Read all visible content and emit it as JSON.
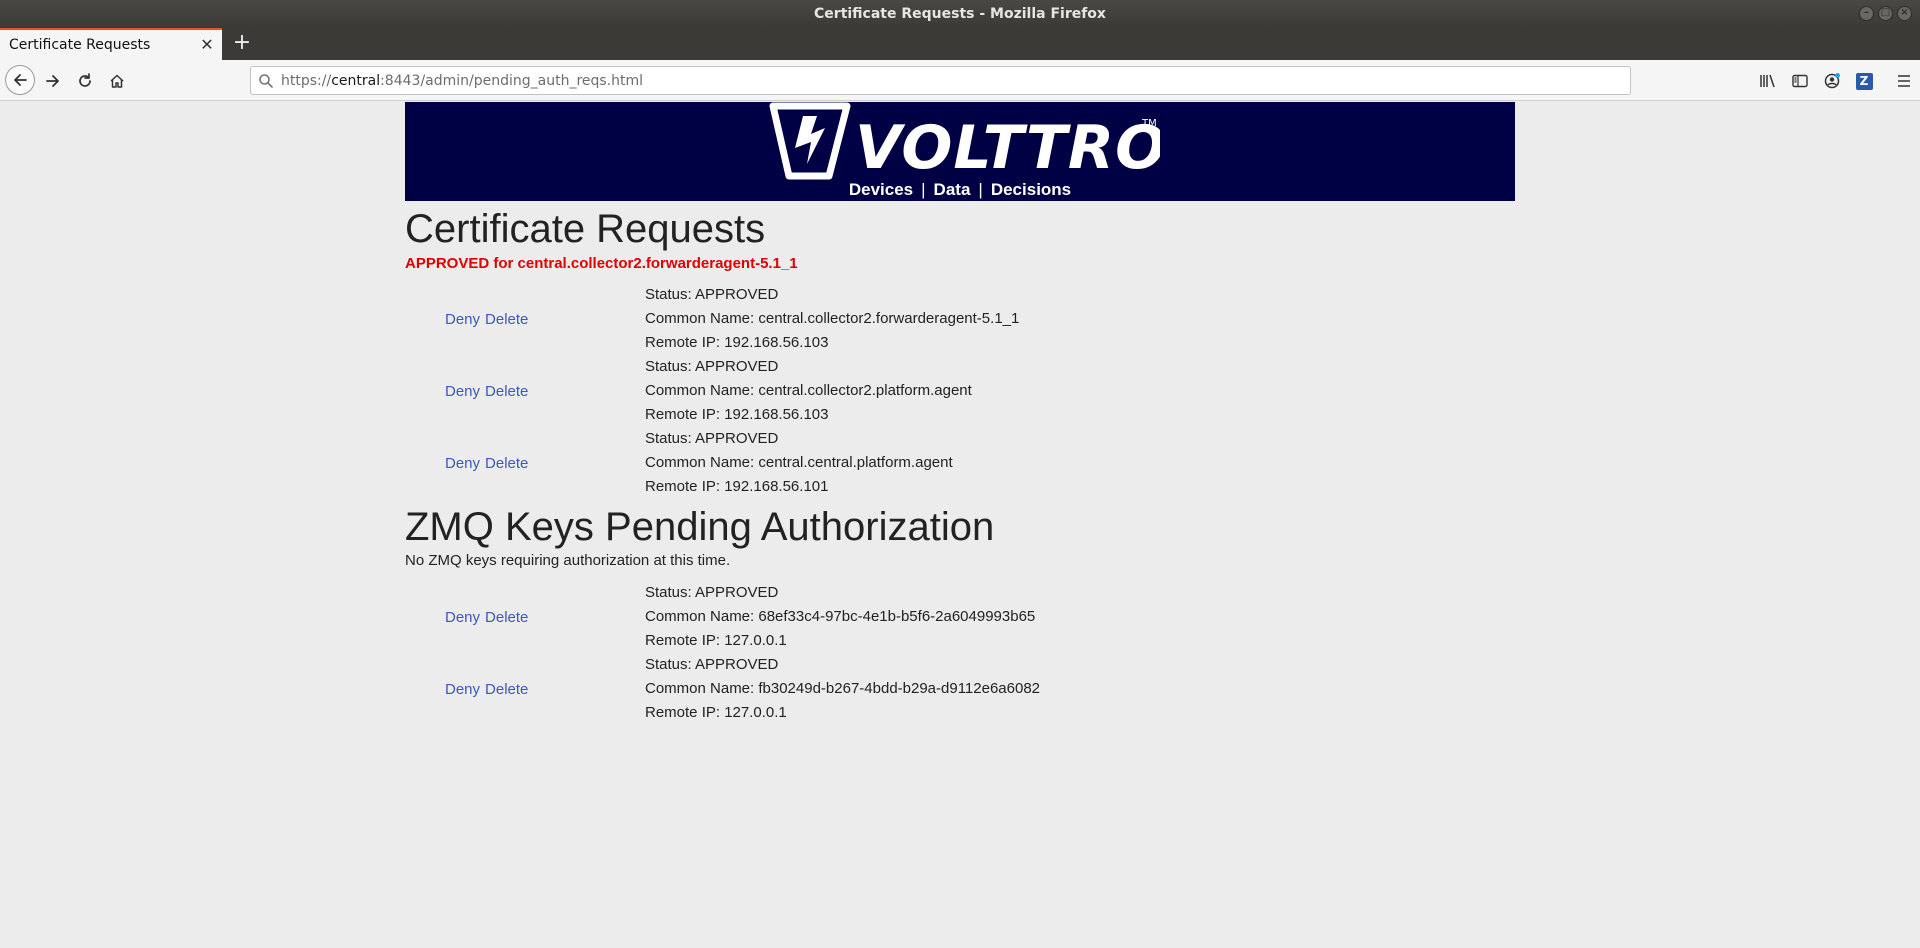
{
  "window": {
    "title": "Certificate Requests - Mozilla Firefox"
  },
  "tab": {
    "title": "Certificate Requests"
  },
  "navbar": {
    "url_prefix": "https://",
    "url_host": "central",
    "url_rest": ":8443/admin/pending_auth_reqs.html"
  },
  "banner": {
    "brand": "VOLTTRON",
    "tm": "TM",
    "nav": [
      "Devices",
      "Data",
      "Decisions"
    ]
  },
  "cert_section": {
    "title": "Certificate Requests",
    "message": "APPROVED for central.collector2.forwarderagent-5.1_1",
    "deny_label": "Deny",
    "delete_label": "Delete",
    "requests": [
      {
        "status": "Status: APPROVED",
        "common_name": "Common Name: central.collector2.forwarderagent-5.1_1",
        "remote_ip": "Remote IP: 192.168.56.103"
      },
      {
        "status": "Status: APPROVED",
        "common_name": "Common Name: central.collector2.platform.agent",
        "remote_ip": "Remote IP: 192.168.56.103"
      },
      {
        "status": "Status: APPROVED",
        "common_name": "Common Name: central.central.platform.agent",
        "remote_ip": "Remote IP: 192.168.56.101"
      }
    ]
  },
  "zmq_section": {
    "title": "ZMQ Keys Pending Authorization",
    "message": "No ZMQ keys requiring authorization at this time.",
    "deny_label": "Deny",
    "delete_label": "Delete",
    "requests": [
      {
        "status": "Status: APPROVED",
        "common_name": "Common Name: 68ef33c4-97bc-4e1b-b5f6-2a6049993b65",
        "remote_ip": "Remote IP: 127.0.0.1"
      },
      {
        "status": "Status: APPROVED",
        "common_name": "Common Name: fb30249d-b267-4bdd-b29a-d9112e6a6082",
        "remote_ip": "Remote IP: 127.0.0.1"
      }
    ]
  },
  "colors": {
    "banner_bg": "#000145",
    "approved_red": "#e00000",
    "link_blue": "#3a5ab8",
    "tab_accent": "#e8571d"
  }
}
